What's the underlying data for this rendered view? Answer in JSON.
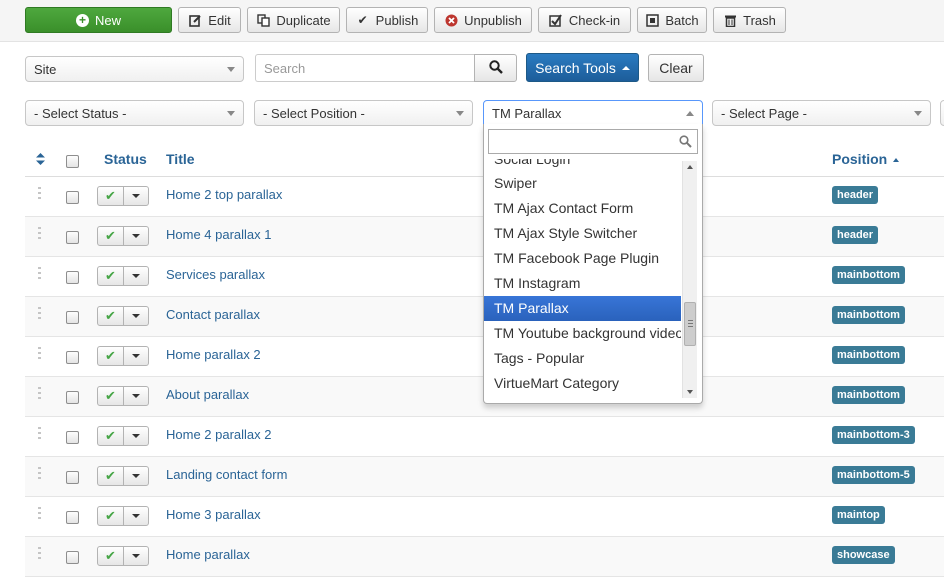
{
  "toolbar": {
    "new": "New",
    "edit": "Edit",
    "duplicate": "Duplicate",
    "publish": "Publish",
    "unpublish": "Unpublish",
    "checkin": "Check-in",
    "batch": "Batch",
    "trash": "Trash"
  },
  "filters": {
    "client": "Site",
    "search_placeholder": "Search",
    "search_tools": "Search Tools",
    "clear": "Clear",
    "status": "- Select Status -",
    "position": "- Select Position -",
    "module": "TM Parallax",
    "page": "- Select Page -"
  },
  "table": {
    "headers": {
      "status": "Status",
      "title": "Title",
      "position": "Position"
    },
    "rows": [
      {
        "title": "Home 2 top parallax",
        "position": "header"
      },
      {
        "title": "Home 4 parallax 1",
        "position": "header"
      },
      {
        "title": "Services parallax",
        "position": "mainbottom"
      },
      {
        "title": "Contact parallax",
        "position": "mainbottom"
      },
      {
        "title": "Home parallax 2",
        "position": "mainbottom"
      },
      {
        "title": "About parallax",
        "position": "mainbottom"
      },
      {
        "title": "Home 2 parallax 2",
        "position": "mainbottom-3"
      },
      {
        "title": "Landing contact form",
        "position": "mainbottom-5"
      },
      {
        "title": "Home 3 parallax",
        "position": "maintop"
      },
      {
        "title": "Home parallax",
        "position": "showcase"
      }
    ]
  },
  "dropdown": {
    "search_value": "",
    "items": [
      "Social Login",
      "Swiper",
      "TM Ajax Contact Form",
      "TM Ajax Style Switcher",
      "TM Facebook Page Plugin",
      "TM Instagram",
      "TM Parallax",
      "TM Youtube background video",
      "Tags - Popular",
      "VirtueMart Category"
    ],
    "selected": "TM Parallax"
  },
  "colors": {
    "accent": "#2a6496",
    "primary_button": "#1d5d9a",
    "new_button": "#3a8f2a",
    "badge": "#3a7b96",
    "highlight": "#3875d7"
  }
}
